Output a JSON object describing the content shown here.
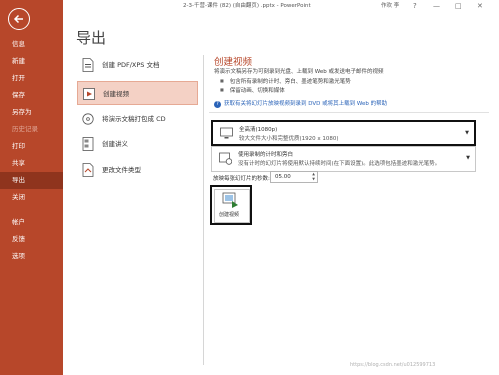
{
  "window": {
    "title": "2-3-千营-课件 (82) (自由翻页) .pptx - PowerPoint",
    "user": "作欢 李",
    "help": "?",
    "minimize": "—",
    "maximize": "□",
    "close": "✕"
  },
  "sidebar": {
    "items": [
      {
        "label": "信息"
      },
      {
        "label": "新建"
      },
      {
        "label": "打开"
      },
      {
        "label": "保存"
      },
      {
        "label": "另存为"
      },
      {
        "label": "历史记录"
      },
      {
        "label": "打印"
      },
      {
        "label": "共享"
      },
      {
        "label": "导出"
      },
      {
        "label": "关闭"
      },
      {
        "label": "帐户"
      },
      {
        "label": "反馈"
      },
      {
        "label": "选项"
      }
    ],
    "active_index": 8,
    "accent_color": "#b7472a"
  },
  "page_title": "导出",
  "export_options": [
    {
      "label": "创建 PDF/XPS 文档",
      "icon": "pdf-document-icon"
    },
    {
      "label": "创建视频",
      "icon": "video-icon"
    },
    {
      "label": "将演示文稿打包成 CD",
      "icon": "cd-package-icon"
    },
    {
      "label": "创建讲义",
      "icon": "handout-icon"
    },
    {
      "label": "更改文件类型",
      "icon": "file-type-icon"
    }
  ],
  "create_video": {
    "title": "创建视频",
    "description": "将演示文稿另存为可刻录到光盘、上载到 Web 或发送电子邮件的视频",
    "bullets": [
      "包含所有录制的计时、旁白、墨迹笔势和激光笔势",
      "保留动画、切换和媒体"
    ],
    "help_link": "获取有关将幻灯片放映视频刻录到 DVD 或将其上载到 Web 的帮助",
    "quality_dropdown": {
      "main": "全高清(1080p)",
      "sub": "较大文件大小和完整优质(1920 x 1080)"
    },
    "timing_dropdown": {
      "main": "使用录制的计时和旁白",
      "sub": "没有计时的幻灯片将使用默认持续时间(在下面设置)。此选项包括墨迹和激光笔势。"
    },
    "seconds_label": "放映每张幻灯片的秒数:",
    "seconds_value": "05.00",
    "create_button": "创建视频"
  },
  "watermark": "https://blog.csdn.net/u012599713"
}
